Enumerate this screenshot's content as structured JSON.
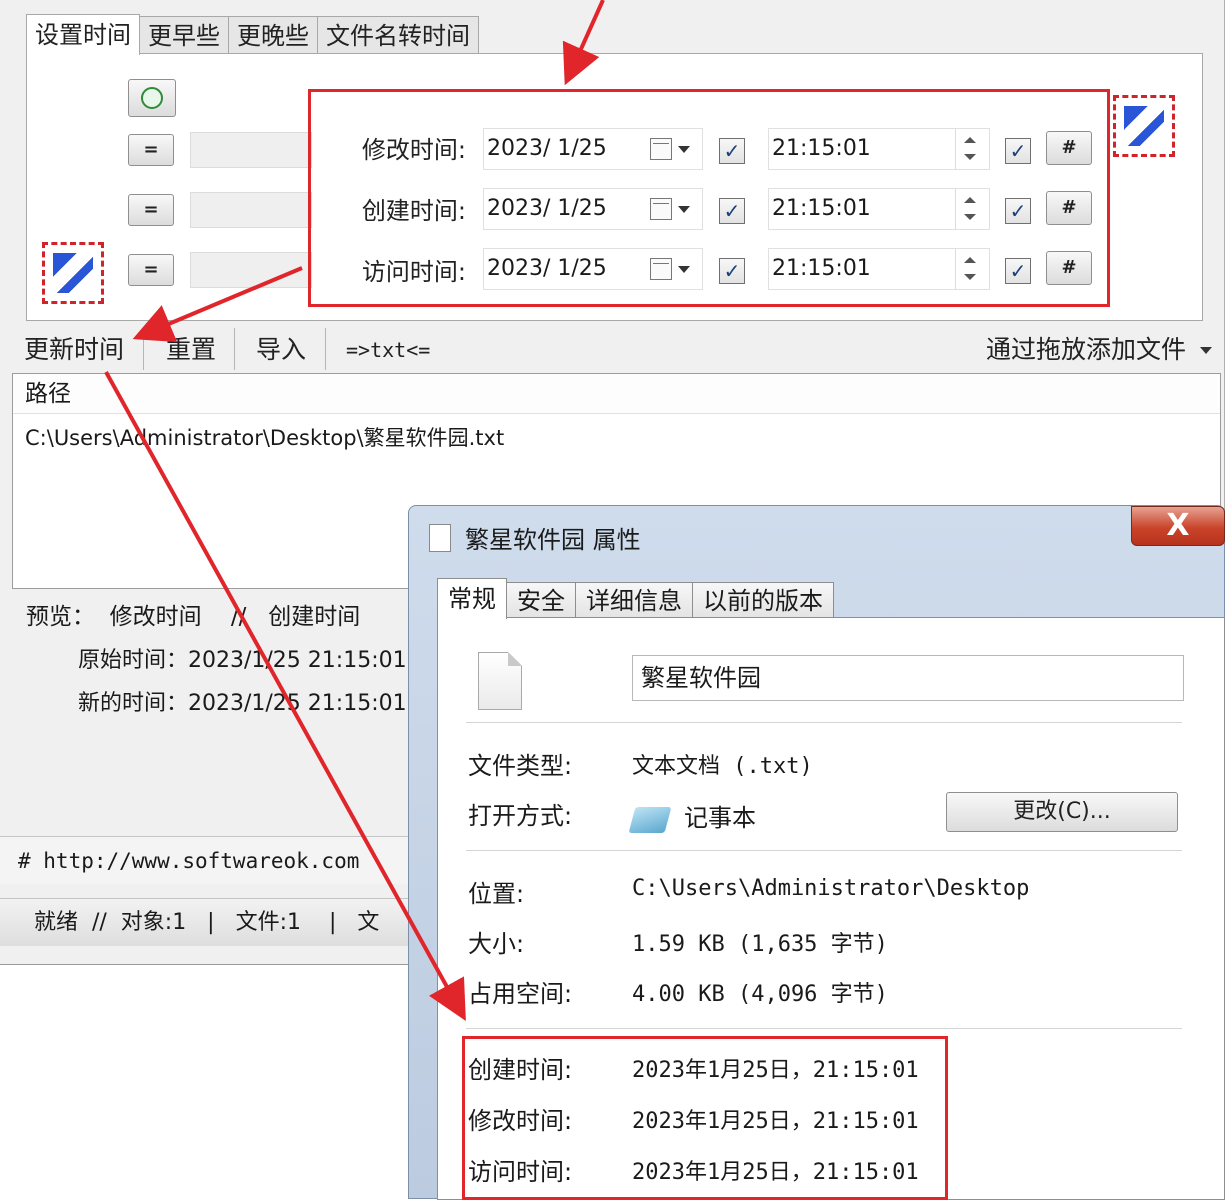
{
  "app": {
    "tabs": [
      "设置时间",
      "更早些",
      "更晚些",
      "文件名转时间"
    ],
    "rows": [
      {
        "label": "修改时间:",
        "date": "2023/  1/25",
        "time": "21:15:01"
      },
      {
        "label": "创建时间:",
        "date": "2023/  1/25",
        "time": "21:15:01"
      },
      {
        "label": "访问时间:",
        "date": "2023/  1/25",
        "time": "21:15:01"
      }
    ],
    "equal_label": "=",
    "hash_label": "#",
    "check_mark": "✓",
    "toolbar": {
      "update": "更新时间",
      "reset": "重置",
      "import": "导入",
      "txt": "=>txt<=",
      "drag_add": "通过拖放添加文件"
    },
    "list": {
      "header": "路径",
      "rows": [
        "C:\\Users\\Administrator\\Desktop\\繁星软件园.txt"
      ]
    },
    "preview": {
      "line": "预览：  修改时间    //   创建时间",
      "original": "原始时间：2023/1/25 21:15:01",
      "new": "新的时间：2023/1/25 21:15:01"
    },
    "url": "# http://www.softwareok.com",
    "status": "就绪  //  对象:1   |   文件:1    |   文"
  },
  "dialog": {
    "title": "繁星软件园 属性",
    "close": "X",
    "tabs": [
      "常规",
      "安全",
      "详细信息",
      "以前的版本"
    ],
    "filename": "繁星软件园",
    "properties": {
      "type_label": "文件类型:",
      "type_value": "文本文档 (.txt)",
      "open_label": "打开方式:",
      "open_value": "记事本",
      "change_button": "更改(C)...",
      "location_label": "位置:",
      "location_value": "C:\\Users\\Administrator\\Desktop",
      "size_label": "大小:",
      "size_value": "1.59 KB (1,635 字节)",
      "disk_label": "占用空间:",
      "disk_value": "4.00 KB (4,096 字节)",
      "created_label": "创建时间:",
      "created_value": "2023年1月25日，21:15:01",
      "modified_label": "修改时间:",
      "modified_value": "2023年1月25日，21:15:01",
      "accessed_label": "访问时间:",
      "accessed_value": "2023年1月25日，21:15:01"
    }
  },
  "colors": {
    "annotation_red": "#e0262b"
  }
}
